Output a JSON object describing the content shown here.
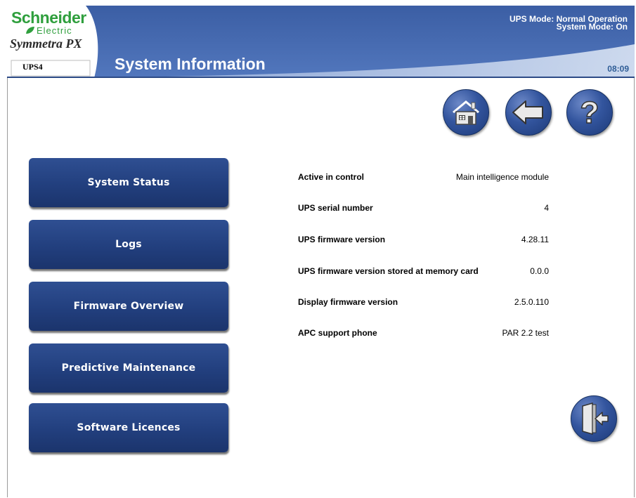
{
  "header": {
    "brand_name": "Schneider",
    "brand_sub": "Electric",
    "product_name": "Symmetra PX",
    "ups_id": "UPS4",
    "page_title": "System Information",
    "ups_mode": "UPS Mode: Normal Operation",
    "system_mode": "System Mode: On",
    "clock": "08:09",
    "colors": {
      "header_blue": "#3f63a8",
      "brand_green": "#2f9f3d"
    }
  },
  "nav_icons": {
    "home": "home-icon",
    "back": "back-arrow-icon",
    "help": "help-icon",
    "exit": "exit-door-icon"
  },
  "menu": [
    {
      "label": "System Status"
    },
    {
      "label": "Logs"
    },
    {
      "label": "Firmware Overview"
    },
    {
      "label": "Predictive Maintenance"
    },
    {
      "label": "Software Licences"
    }
  ],
  "info": [
    {
      "label": "Active in control",
      "value": "Main intelligence module"
    },
    {
      "label": "UPS serial number",
      "value": "4"
    },
    {
      "label": "UPS firmware version",
      "value": "4.28.11"
    },
    {
      "label": "UPS firmware version stored at memory card",
      "value": "0.0.0"
    },
    {
      "label": "Display firmware version",
      "value": "2.5.0.110"
    },
    {
      "label": "APC support phone",
      "value": "PAR 2.2 test"
    }
  ]
}
